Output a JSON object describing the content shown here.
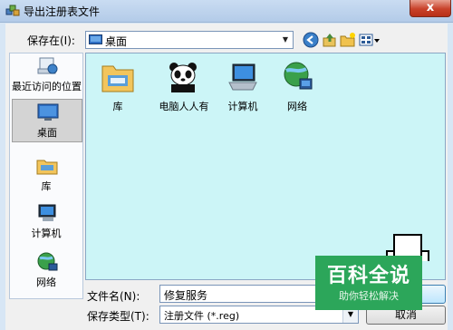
{
  "window": {
    "title": "导出注册表文件",
    "close_label": "x"
  },
  "toolbar": {
    "save_in_label": "保存在(I):",
    "location": "桌面",
    "icons": [
      "back-icon",
      "up-folder-icon",
      "new-folder-icon",
      "view-menu-icon"
    ]
  },
  "places": [
    {
      "label": "最近访问的位置",
      "icon": "recent-places-icon"
    },
    {
      "label": "桌面",
      "icon": "desktop-icon",
      "selected": true
    },
    {
      "label": "库",
      "icon": "libraries-icon"
    },
    {
      "label": "计算机",
      "icon": "computer-icon"
    },
    {
      "label": "网络",
      "icon": "network-icon"
    }
  ],
  "files": [
    {
      "label": "库",
      "icon": "libraries-icon"
    },
    {
      "label": "电脑人人有",
      "icon": "panda-icon"
    },
    {
      "label": "计算机",
      "icon": "computer-icon"
    },
    {
      "label": "网络",
      "icon": "network-icon"
    }
  ],
  "bottom": {
    "filename_label": "文件名(N):",
    "filename_value": "修复服务",
    "filetype_label": "保存类型(T):",
    "filetype_value": "注册文件 (*.reg)",
    "cancel_label": "取消"
  },
  "watermark": {
    "main": "百科全说",
    "sub": "助你轻松解决"
  }
}
